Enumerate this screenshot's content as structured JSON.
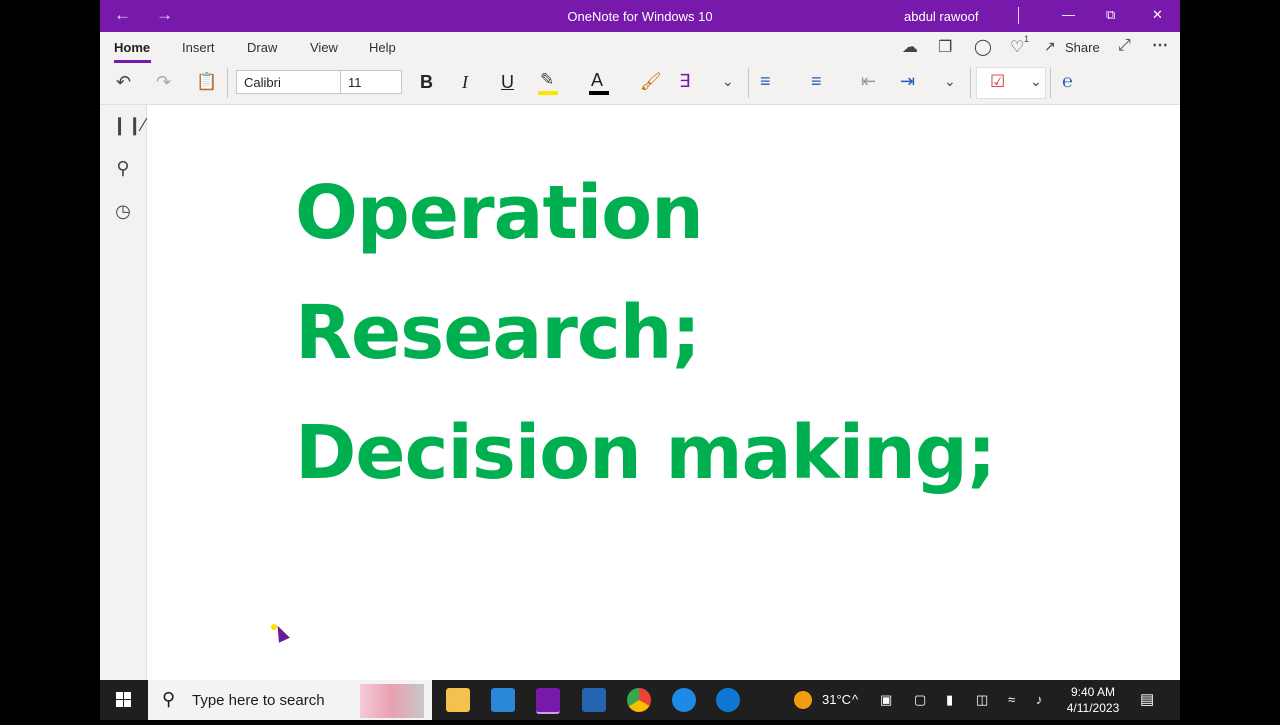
{
  "window": {
    "title": "OneNote for Windows 10",
    "user": "abdul rawoof"
  },
  "ribbon": {
    "tabs": [
      "Home",
      "Insert",
      "Draw",
      "View",
      "Help"
    ],
    "share_label": "Share",
    "notification_count": "1",
    "font_name": "Calibri",
    "font_size": "11",
    "bold_label": "B",
    "italic_label": "I",
    "underline_label": "U",
    "font_color_label": "A"
  },
  "page": {
    "lines": [
      "Operation",
      "Research;",
      "Decision making;"
    ]
  },
  "taskbar": {
    "search_placeholder": "Type here to search",
    "weather": "31°C",
    "time": "9:40 AM",
    "date": "4/11/2023"
  },
  "colors": {
    "accent": "#7719aa",
    "note_text": "#00b050",
    "highlight": "#ffe600",
    "font_color": "#000000"
  }
}
